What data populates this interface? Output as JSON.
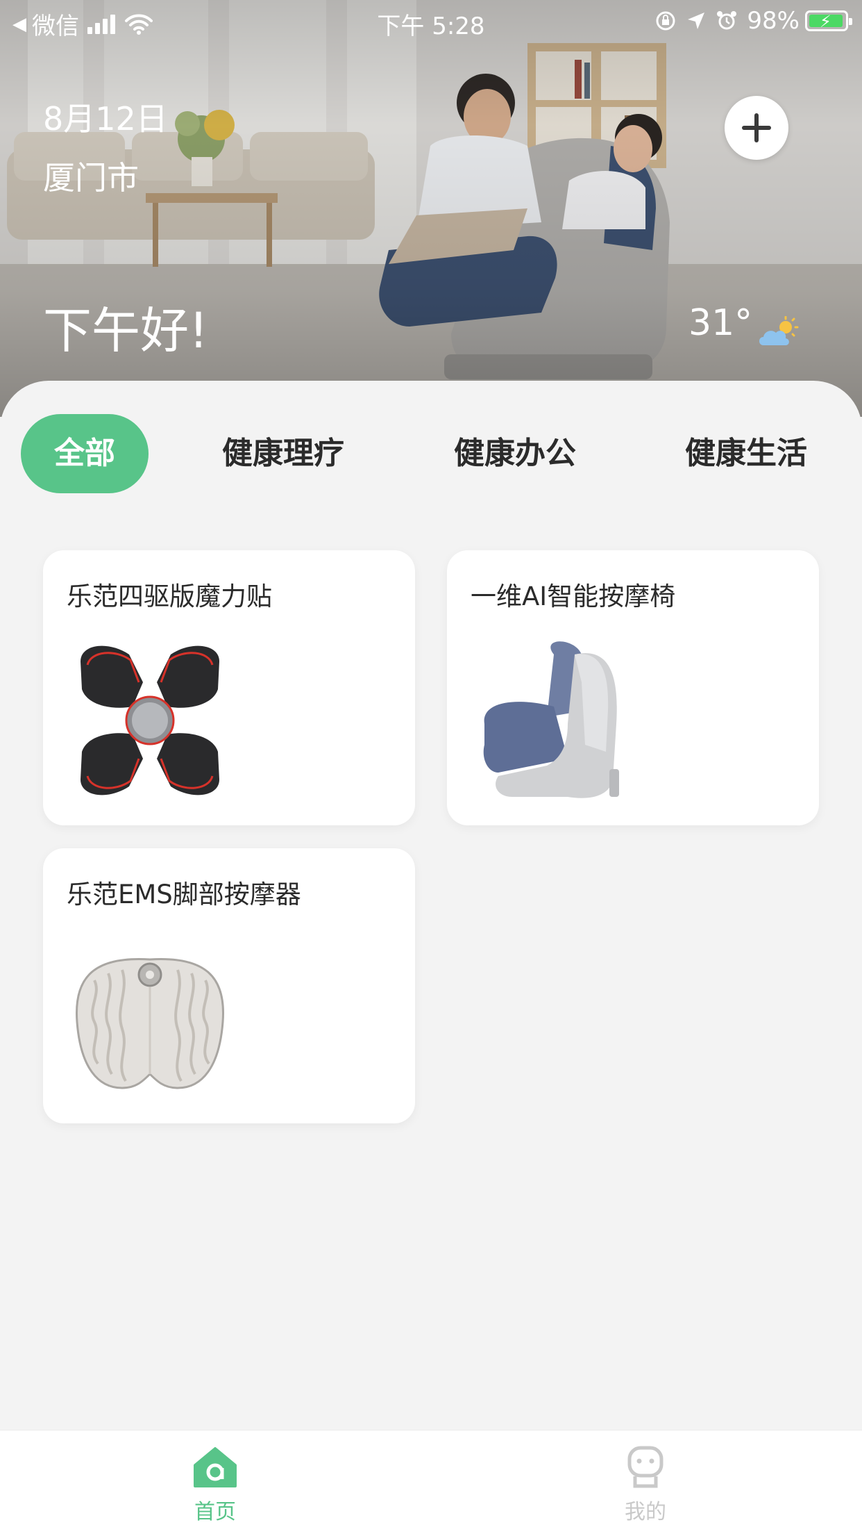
{
  "status_bar": {
    "back_app": "微信",
    "time": "下午 5:28",
    "battery_percent": "98%"
  },
  "hero": {
    "date": "8月12日",
    "city": "厦门市",
    "greeting": "下午好!",
    "temperature": "31°",
    "weather_icon": "partly-cloudy-icon"
  },
  "tabs": [
    {
      "label": "全部",
      "active": true
    },
    {
      "label": "健康理疗",
      "active": false
    },
    {
      "label": "健康办公",
      "active": false
    },
    {
      "label": "健康生活",
      "active": false
    }
  ],
  "devices": [
    {
      "name": "乐范四驱版魔力贴",
      "icon": "massage-patch-image"
    },
    {
      "name": "一维AI智能按摩椅",
      "icon": "massage-chair-image"
    },
    {
      "name": "乐范EMS脚部按摩器",
      "icon": "foot-massager-image"
    }
  ],
  "bottom_nav": [
    {
      "label": "首页",
      "icon": "home-icon",
      "active": true
    },
    {
      "label": "我的",
      "icon": "profile-icon",
      "active": false
    }
  ],
  "colors": {
    "accent": "#58c489",
    "background": "#f3f3f3",
    "card": "#ffffff",
    "inactive_nav": "#c9c9c9"
  }
}
